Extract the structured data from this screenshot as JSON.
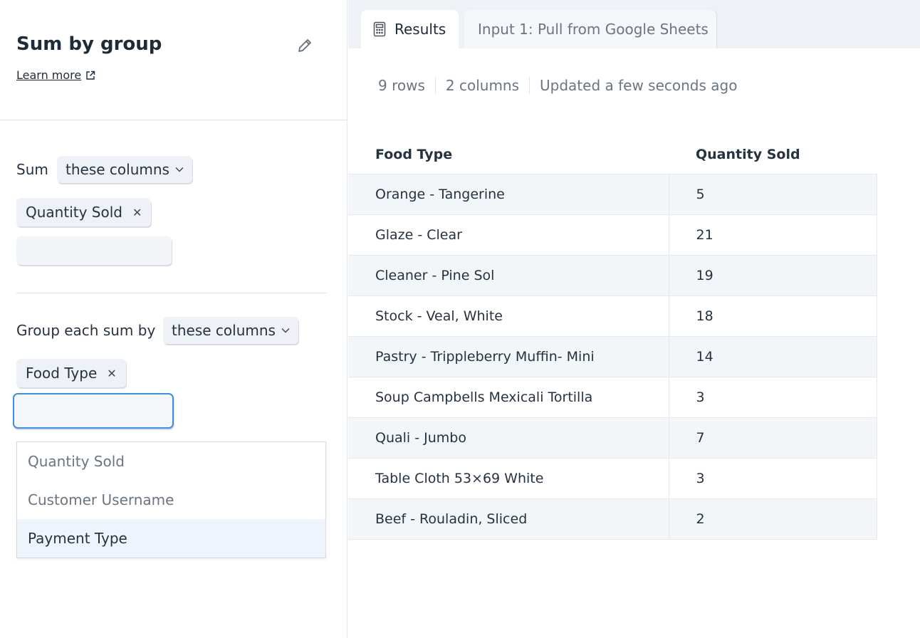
{
  "step": {
    "title": "Sum by group",
    "learn_more": "Learn more"
  },
  "sum": {
    "label": "Sum",
    "mode": "these columns",
    "columns": [
      "Quantity Sold"
    ],
    "input_value": ""
  },
  "group": {
    "label": "Group each sum by",
    "mode": "these columns",
    "columns": [
      "Food Type"
    ],
    "input_value": "",
    "dropdown_options": [
      "Quantity Sold",
      "Customer Username",
      "Payment Type"
    ],
    "highlighted_option": "Payment Type"
  },
  "tabs": [
    {
      "label": "Results",
      "icon": "calculator-icon",
      "active": true
    },
    {
      "label": "Input 1: Pull from Google Sheets",
      "active": false
    }
  ],
  "meta": {
    "rows": "9 rows",
    "columns": "2 columns",
    "updated": "Updated a few seconds ago"
  },
  "table": {
    "headers": [
      "Food Type",
      "Quantity Sold"
    ],
    "rows": [
      [
        "Orange - Tangerine",
        "5"
      ],
      [
        "Glaze - Clear",
        "21"
      ],
      [
        "Cleaner - Pine Sol",
        "19"
      ],
      [
        "Stock - Veal, White",
        "18"
      ],
      [
        "Pastry - Trippleberry Muffin- Mini",
        "14"
      ],
      [
        "Soup Campbells Mexicali Tortilla",
        "3"
      ],
      [
        "Quali - Jumbo",
        "7"
      ],
      [
        "Table Cloth 53×69 White",
        "3"
      ],
      [
        "Beef - Rouladin, Sliced",
        "2"
      ]
    ]
  }
}
